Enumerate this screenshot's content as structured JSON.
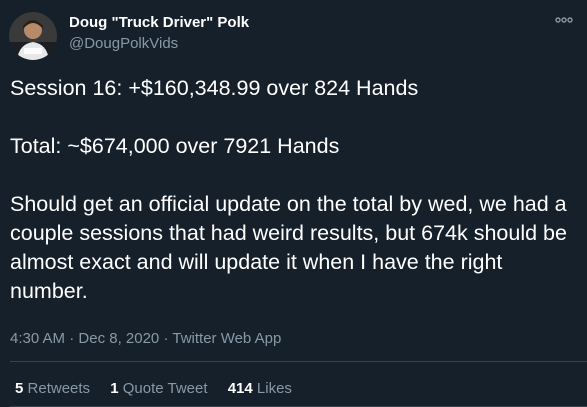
{
  "author": {
    "name": "Doug \"Truck Driver\" Polk",
    "handle": "@DougPolkVids",
    "avatar_icon": "profile-photo"
  },
  "tweet": {
    "lines": [
      "Session 16: +$160,348.99 over 824 Hands",
      "Total: ~$674,000 over 7921 Hands",
      "Should get an official update on the total by wed, we had a couple sessions that had weird results, but 674k should be almost exact and will update it when I have the right number."
    ]
  },
  "meta": {
    "time": "4:30 AM",
    "date": "Dec 8, 2020",
    "source": "Twitter Web App",
    "separator": "·"
  },
  "stats": {
    "retweets_count": "5",
    "retweets_label": "Retweets",
    "quotes_count": "1",
    "quotes_label": "Quote Tweet",
    "likes_count": "414",
    "likes_label": "Likes"
  },
  "colors": {
    "background": "#15202b",
    "text": "#ffffff",
    "secondary": "#8899a6",
    "divider": "#38444d"
  },
  "icons": {
    "more": "more-options-icon"
  }
}
